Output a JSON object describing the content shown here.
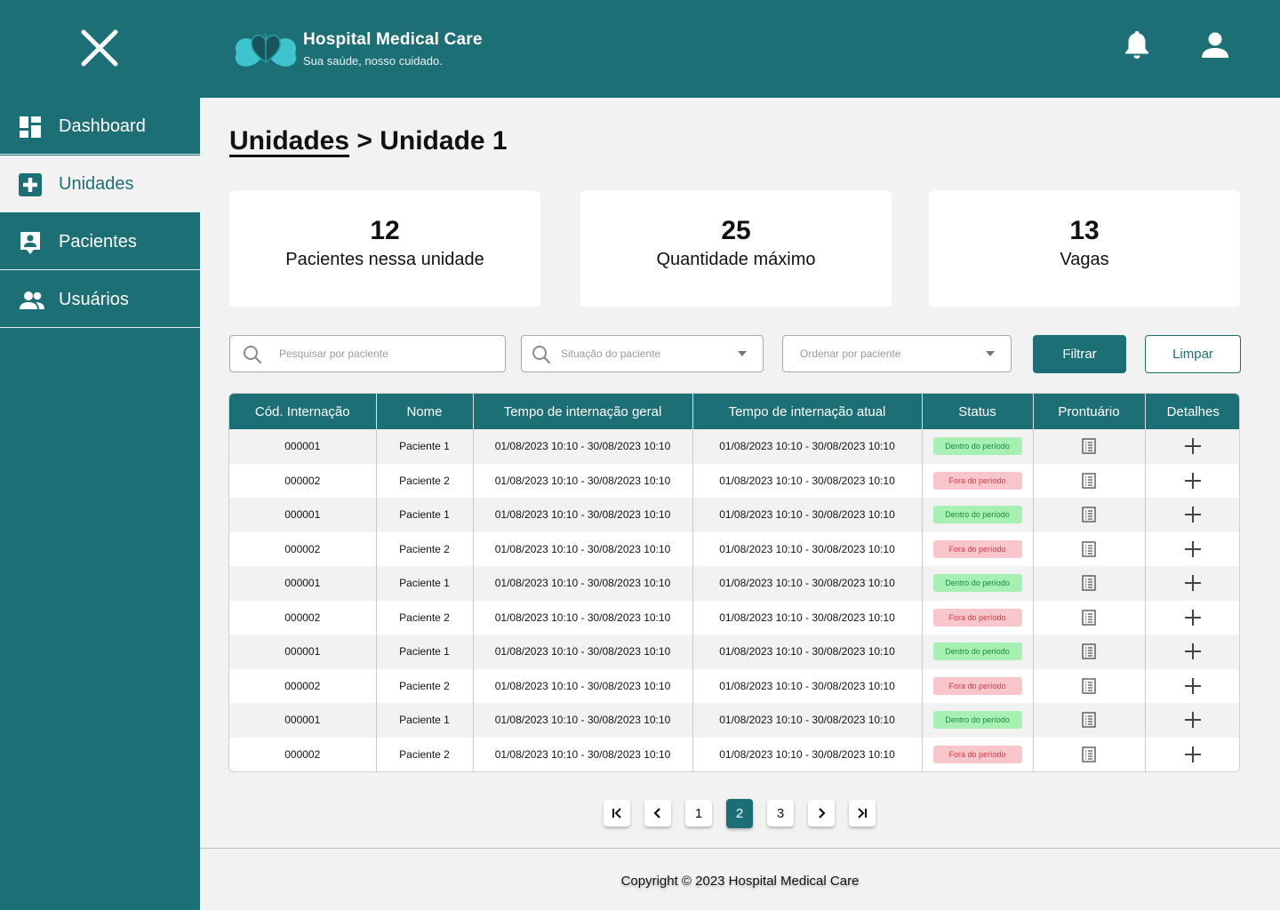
{
  "brand": {
    "title": "Hospital Medical Care",
    "subtitle": "Sua saúde, nosso cuidado."
  },
  "colors": {
    "primary": "#1d6f76",
    "background": "#f2f2f2",
    "badge_in_bg": "#a7f0b4",
    "badge_out_bg": "#f9c7cb"
  },
  "sidebar": {
    "items": [
      {
        "label": "Dashboard",
        "icon": "dashboard-icon",
        "active": false
      },
      {
        "label": "Unidades",
        "icon": "hospital-plus-icon",
        "active": true
      },
      {
        "label": "Pacientes",
        "icon": "patient-badge-icon",
        "active": false
      },
      {
        "label": "Usuários",
        "icon": "users-icon",
        "active": false
      }
    ]
  },
  "breadcrumb": {
    "parent": "Unidades",
    "separator": " > ",
    "current": "Unidade 1"
  },
  "stats": [
    {
      "value": "12",
      "label": "Pacientes nessa unidade"
    },
    {
      "value": "25",
      "label": "Quantidade máximo"
    },
    {
      "value": "13",
      "label": "Vagas"
    }
  ],
  "filters": {
    "search_placeholder": "Pesquisar por paciente",
    "status_placeholder": "Situação do paciente",
    "order_placeholder": "Ordenar por paciente",
    "filter_label": "Filtrar",
    "clear_label": "Limpar"
  },
  "table": {
    "headers": [
      "Cód. Internação",
      "Nome",
      "Tempo de internação geral",
      "Tempo de internação atual",
      "Status",
      "Prontuário",
      "Detalhes"
    ],
    "rows": [
      {
        "code": "000001",
        "name": "Paciente 1",
        "general": "01/08/2023 10:10 - 30/08/2023 10:10",
        "current": "01/08/2023 10:10 - 30/08/2023 10:10",
        "status": "Dentro do período",
        "in": true
      },
      {
        "code": "000002",
        "name": "Paciente 2",
        "general": "01/08/2023 10:10 - 30/08/2023 10:10",
        "current": "01/08/2023 10:10 - 30/08/2023 10:10",
        "status": "Fora do período",
        "in": false
      },
      {
        "code": "000001",
        "name": "Paciente 1",
        "general": "01/08/2023 10:10 - 30/08/2023 10:10",
        "current": "01/08/2023 10:10 - 30/08/2023 10:10",
        "status": "Dentro do período",
        "in": true
      },
      {
        "code": "000002",
        "name": "Paciente 2",
        "general": "01/08/2023 10:10 - 30/08/2023 10:10",
        "current": "01/08/2023 10:10 - 30/08/2023 10:10",
        "status": "Fora do período",
        "in": false
      },
      {
        "code": "000001",
        "name": "Paciente 1",
        "general": "01/08/2023 10:10 - 30/08/2023 10:10",
        "current": "01/08/2023 10:10 - 30/08/2023 10:10",
        "status": "Dentro do período",
        "in": true
      },
      {
        "code": "000002",
        "name": "Paciente 2",
        "general": "01/08/2023 10:10 - 30/08/2023 10:10",
        "current": "01/08/2023 10:10 - 30/08/2023 10:10",
        "status": "Fora do período",
        "in": false
      },
      {
        "code": "000001",
        "name": "Paciente 1",
        "general": "01/08/2023 10:10 - 30/08/2023 10:10",
        "current": "01/08/2023 10:10 - 30/08/2023 10:10",
        "status": "Dentro do período",
        "in": true
      },
      {
        "code": "000002",
        "name": "Paciente 2",
        "general": "01/08/2023 10:10 - 30/08/2023 10:10",
        "current": "01/08/2023 10:10 - 30/08/2023 10:10",
        "status": "Fora do período",
        "in": false
      },
      {
        "code": "000001",
        "name": "Paciente 1",
        "general": "01/08/2023 10:10 - 30/08/2023 10:10",
        "current": "01/08/2023 10:10 - 30/08/2023 10:10",
        "status": "Dentro do período",
        "in": true
      },
      {
        "code": "000002",
        "name": "Paciente 2",
        "general": "01/08/2023 10:10 - 30/08/2023 10:10",
        "current": "01/08/2023 10:10 - 30/08/2023 10:10",
        "status": "Fora do período",
        "in": false
      }
    ]
  },
  "pagination": {
    "pages": [
      "1",
      "2",
      "3"
    ],
    "current": "2"
  },
  "footer": {
    "copyright": "Copyright © 2023 Hospital Medical Care"
  }
}
